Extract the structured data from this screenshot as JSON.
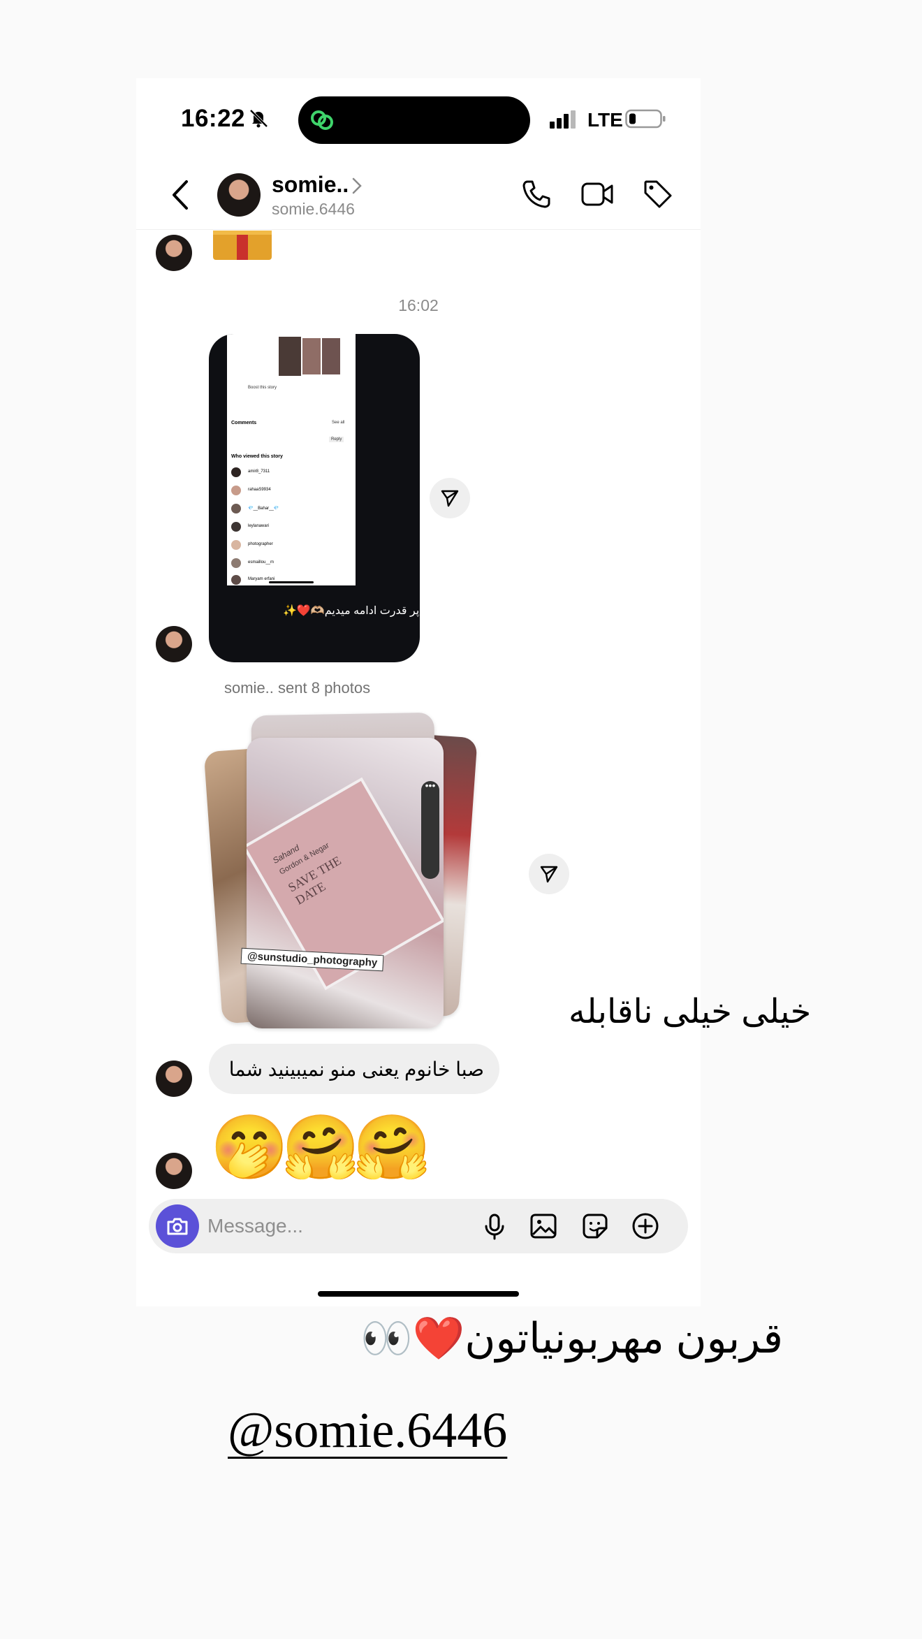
{
  "status_bar": {
    "time": "16:22",
    "network": "LTE"
  },
  "header": {
    "name": "somie..",
    "username": "somie.6446"
  },
  "conversation": {
    "timestamp": "16:02",
    "story_caption": "پر قدرت ادامه میدیم🫶🏼❤️✨",
    "story_preview": {
      "rows": [
        "Boost this story",
        "Comments",
        "See all",
        "Reply",
        "Who viewed this story"
      ],
      "viewers": [
        "amir8_7311",
        "rahaaS9934",
        "💎__Bahar__💎",
        "leylanawari",
        "photographer",
        "esmaillou__m",
        "Maryam erfani"
      ]
    },
    "sent_label": "somie.. sent 8 photos",
    "photo_watermark": "@sunstudio_photography",
    "photo_card_text": [
      "Sahand",
      "Gordon & Negar",
      "SAVE THE DATE"
    ],
    "message_text": "صبا خانوم یعنی منو نمیبینید شما",
    "emojis": [
      "🤭",
      "🤗",
      "🤗"
    ]
  },
  "composer": {
    "placeholder": "Message..."
  },
  "overlay": {
    "text_1": "خیلی خیلی ناقابله",
    "text_2": "قربون مهربونیاتون❤️👀",
    "mention": "@somie.6446"
  },
  "colors": {
    "background": "#fafafa",
    "bubble": "#efefef",
    "camera_button": "#5b51d8",
    "secondary_text": "#8a8a8a"
  }
}
